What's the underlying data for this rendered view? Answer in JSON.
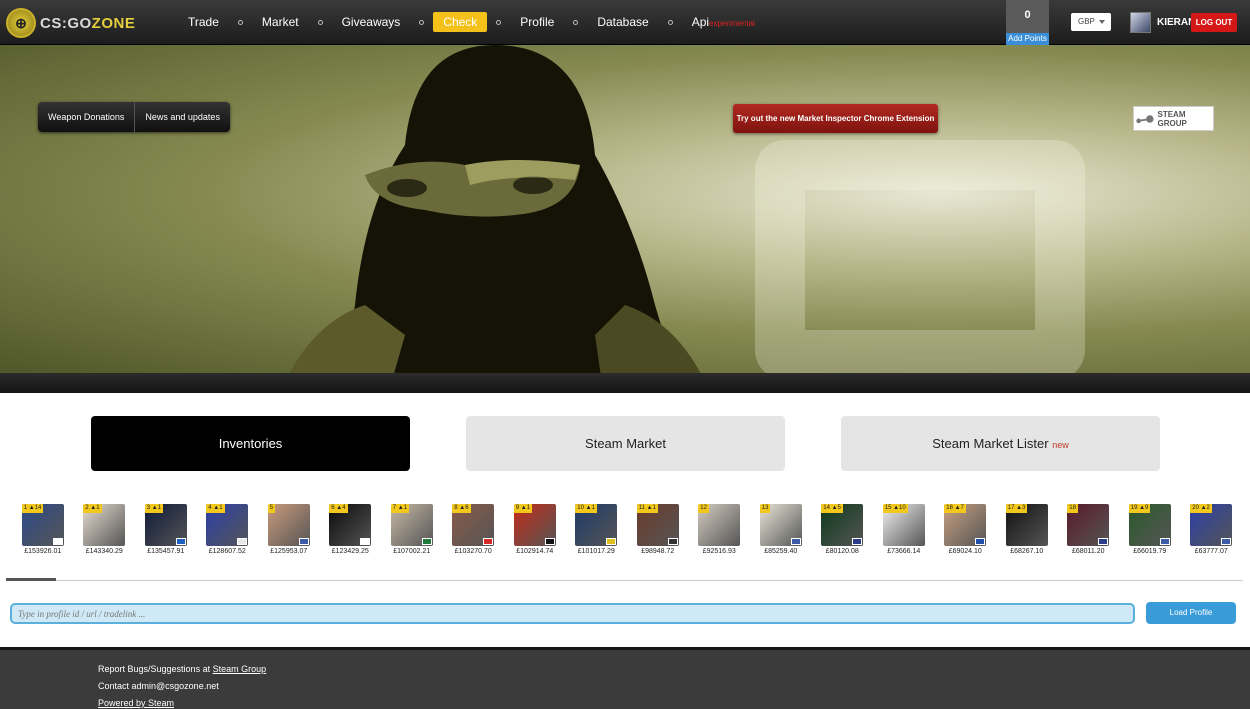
{
  "header": {
    "logo": {
      "text_cs": "CS:GO",
      "text_zone": "ZONE"
    },
    "nav": [
      {
        "label": "Trade",
        "active": false
      },
      {
        "label": "Market",
        "active": false
      },
      {
        "label": "Giveaways",
        "active": false
      },
      {
        "label": "Check",
        "active": true
      },
      {
        "label": "Profile",
        "active": false
      },
      {
        "label": "Database",
        "active": false
      }
    ],
    "api": {
      "label": "Api",
      "sup": "experimental"
    },
    "points": {
      "value": "0",
      "button": "Add Points"
    },
    "currency": "GBP",
    "username": "KIERAN",
    "logout": "LOG OUT"
  },
  "hero": {
    "tabs": [
      "Weapon Donations",
      "News and updates"
    ],
    "promo": "Try out the new Market Inspector Chrome Extension",
    "steam_group": "STEAM GROUP"
  },
  "tabs": [
    {
      "label": "Inventories",
      "active": true
    },
    {
      "label": "Steam Market",
      "active": false
    },
    {
      "label": "Steam Market Lister",
      "badge": "new",
      "active": false
    }
  ],
  "inventories": [
    {
      "rank": "1 ▲14",
      "value": "£153926.01",
      "color": "#2c4a8a",
      "flag": "#ffffff"
    },
    {
      "rank": "2 ▲1",
      "value": "£143340.29",
      "color": "#e7ddd0",
      "flag": ""
    },
    {
      "rank": "3 ▲1",
      "value": "£135457.91",
      "color": "#0e1a3a",
      "flag": "#1f5fbf"
    },
    {
      "rank": "4 ▲1",
      "value": "£128607.52",
      "color": "#2a3ea8",
      "flag": "#e8e8e8"
    },
    {
      "rank": "5",
      "value": "£125953.07",
      "color": "#c99a7a",
      "flag": "#3c5ca8"
    },
    {
      "rank": "6 ▲4",
      "value": "£123429.25",
      "color": "#0a0a0a",
      "flag": "#ffffff"
    },
    {
      "rank": "7 ▲1",
      "value": "£107002.21",
      "color": "#c7b9a5",
      "flag": "#1f7a3c"
    },
    {
      "rank": "8 ▲6",
      "value": "£103270.70",
      "color": "#8a5a4a",
      "flag": "#d62a2a"
    },
    {
      "rank": "9 ▲1",
      "value": "£102914.74",
      "color": "#c42b1a",
      "flag": "#111111"
    },
    {
      "rank": "10 ▲1",
      "value": "£101017.29",
      "color": "#1e3a6a",
      "flag": "#e0c020"
    },
    {
      "rank": "11 ▲1",
      "value": "£98948.72",
      "color": "#6b3a2a",
      "flag": "#333333"
    },
    {
      "rank": "12",
      "value": "£92516.93",
      "color": "#d4ccc0",
      "flag": ""
    },
    {
      "rank": "13",
      "value": "£85259.40",
      "color": "#e8e6d8",
      "flag": "#3c5ca8"
    },
    {
      "rank": "14 ▲5",
      "value": "£80120.08",
      "color": "#0d3a1a",
      "flag": "#2c3c88"
    },
    {
      "rank": "15 ▲10",
      "value": "£73666.14",
      "color": "#f2f2f2",
      "flag": ""
    },
    {
      "rank": "16 ▲7",
      "value": "£69024.10",
      "color": "#c9a080",
      "flag": "#1f4fa8"
    },
    {
      "rank": "17 ▲3",
      "value": "£68267.10",
      "color": "#111111",
      "flag": ""
    },
    {
      "rank": "18",
      "value": "£68011.20",
      "color": "#5a1a2a",
      "flag": "#2c3c88"
    },
    {
      "rank": "19 ▲9",
      "value": "£66019.79",
      "color": "#2a5a2a",
      "flag": "#3c5ca8"
    },
    {
      "rank": "20 ▲2",
      "value": "£63777.07",
      "color": "#2a3ea8",
      "flag": "#3c5ca8"
    }
  ],
  "search": {
    "placeholder": "Type in profile id / url / tradelink ...",
    "button": "Load Profile"
  },
  "footer": {
    "bugs_prefix": "Report Bugs/Suggestions at",
    "bugs_link": "Steam Group",
    "contact": "Contact admin@csgozone.net",
    "powered": "Powered by Steam"
  }
}
